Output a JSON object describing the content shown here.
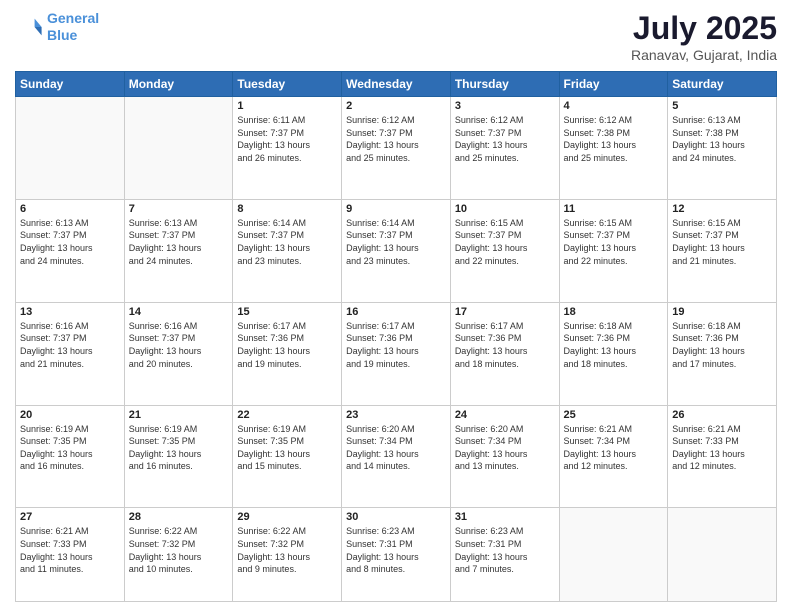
{
  "logo": {
    "line1": "General",
    "line2": "Blue"
  },
  "header": {
    "month": "July 2025",
    "location": "Ranavav, Gujarat, India"
  },
  "weekdays": [
    "Sunday",
    "Monday",
    "Tuesday",
    "Wednesday",
    "Thursday",
    "Friday",
    "Saturday"
  ],
  "weeks": [
    [
      {
        "day": "",
        "info": ""
      },
      {
        "day": "",
        "info": ""
      },
      {
        "day": "1",
        "info": "Sunrise: 6:11 AM\nSunset: 7:37 PM\nDaylight: 13 hours\nand 26 minutes."
      },
      {
        "day": "2",
        "info": "Sunrise: 6:12 AM\nSunset: 7:37 PM\nDaylight: 13 hours\nand 25 minutes."
      },
      {
        "day": "3",
        "info": "Sunrise: 6:12 AM\nSunset: 7:37 PM\nDaylight: 13 hours\nand 25 minutes."
      },
      {
        "day": "4",
        "info": "Sunrise: 6:12 AM\nSunset: 7:38 PM\nDaylight: 13 hours\nand 25 minutes."
      },
      {
        "day": "5",
        "info": "Sunrise: 6:13 AM\nSunset: 7:38 PM\nDaylight: 13 hours\nand 24 minutes."
      }
    ],
    [
      {
        "day": "6",
        "info": "Sunrise: 6:13 AM\nSunset: 7:37 PM\nDaylight: 13 hours\nand 24 minutes."
      },
      {
        "day": "7",
        "info": "Sunrise: 6:13 AM\nSunset: 7:37 PM\nDaylight: 13 hours\nand 24 minutes."
      },
      {
        "day": "8",
        "info": "Sunrise: 6:14 AM\nSunset: 7:37 PM\nDaylight: 13 hours\nand 23 minutes."
      },
      {
        "day": "9",
        "info": "Sunrise: 6:14 AM\nSunset: 7:37 PM\nDaylight: 13 hours\nand 23 minutes."
      },
      {
        "day": "10",
        "info": "Sunrise: 6:15 AM\nSunset: 7:37 PM\nDaylight: 13 hours\nand 22 minutes."
      },
      {
        "day": "11",
        "info": "Sunrise: 6:15 AM\nSunset: 7:37 PM\nDaylight: 13 hours\nand 22 minutes."
      },
      {
        "day": "12",
        "info": "Sunrise: 6:15 AM\nSunset: 7:37 PM\nDaylight: 13 hours\nand 21 minutes."
      }
    ],
    [
      {
        "day": "13",
        "info": "Sunrise: 6:16 AM\nSunset: 7:37 PM\nDaylight: 13 hours\nand 21 minutes."
      },
      {
        "day": "14",
        "info": "Sunrise: 6:16 AM\nSunset: 7:37 PM\nDaylight: 13 hours\nand 20 minutes."
      },
      {
        "day": "15",
        "info": "Sunrise: 6:17 AM\nSunset: 7:36 PM\nDaylight: 13 hours\nand 19 minutes."
      },
      {
        "day": "16",
        "info": "Sunrise: 6:17 AM\nSunset: 7:36 PM\nDaylight: 13 hours\nand 19 minutes."
      },
      {
        "day": "17",
        "info": "Sunrise: 6:17 AM\nSunset: 7:36 PM\nDaylight: 13 hours\nand 18 minutes."
      },
      {
        "day": "18",
        "info": "Sunrise: 6:18 AM\nSunset: 7:36 PM\nDaylight: 13 hours\nand 18 minutes."
      },
      {
        "day": "19",
        "info": "Sunrise: 6:18 AM\nSunset: 7:36 PM\nDaylight: 13 hours\nand 17 minutes."
      }
    ],
    [
      {
        "day": "20",
        "info": "Sunrise: 6:19 AM\nSunset: 7:35 PM\nDaylight: 13 hours\nand 16 minutes."
      },
      {
        "day": "21",
        "info": "Sunrise: 6:19 AM\nSunset: 7:35 PM\nDaylight: 13 hours\nand 16 minutes."
      },
      {
        "day": "22",
        "info": "Sunrise: 6:19 AM\nSunset: 7:35 PM\nDaylight: 13 hours\nand 15 minutes."
      },
      {
        "day": "23",
        "info": "Sunrise: 6:20 AM\nSunset: 7:34 PM\nDaylight: 13 hours\nand 14 minutes."
      },
      {
        "day": "24",
        "info": "Sunrise: 6:20 AM\nSunset: 7:34 PM\nDaylight: 13 hours\nand 13 minutes."
      },
      {
        "day": "25",
        "info": "Sunrise: 6:21 AM\nSunset: 7:34 PM\nDaylight: 13 hours\nand 12 minutes."
      },
      {
        "day": "26",
        "info": "Sunrise: 6:21 AM\nSunset: 7:33 PM\nDaylight: 13 hours\nand 12 minutes."
      }
    ],
    [
      {
        "day": "27",
        "info": "Sunrise: 6:21 AM\nSunset: 7:33 PM\nDaylight: 13 hours\nand 11 minutes."
      },
      {
        "day": "28",
        "info": "Sunrise: 6:22 AM\nSunset: 7:32 PM\nDaylight: 13 hours\nand 10 minutes."
      },
      {
        "day": "29",
        "info": "Sunrise: 6:22 AM\nSunset: 7:32 PM\nDaylight: 13 hours\nand 9 minutes."
      },
      {
        "day": "30",
        "info": "Sunrise: 6:23 AM\nSunset: 7:31 PM\nDaylight: 13 hours\nand 8 minutes."
      },
      {
        "day": "31",
        "info": "Sunrise: 6:23 AM\nSunset: 7:31 PM\nDaylight: 13 hours\nand 7 minutes."
      },
      {
        "day": "",
        "info": ""
      },
      {
        "day": "",
        "info": ""
      }
    ]
  ]
}
